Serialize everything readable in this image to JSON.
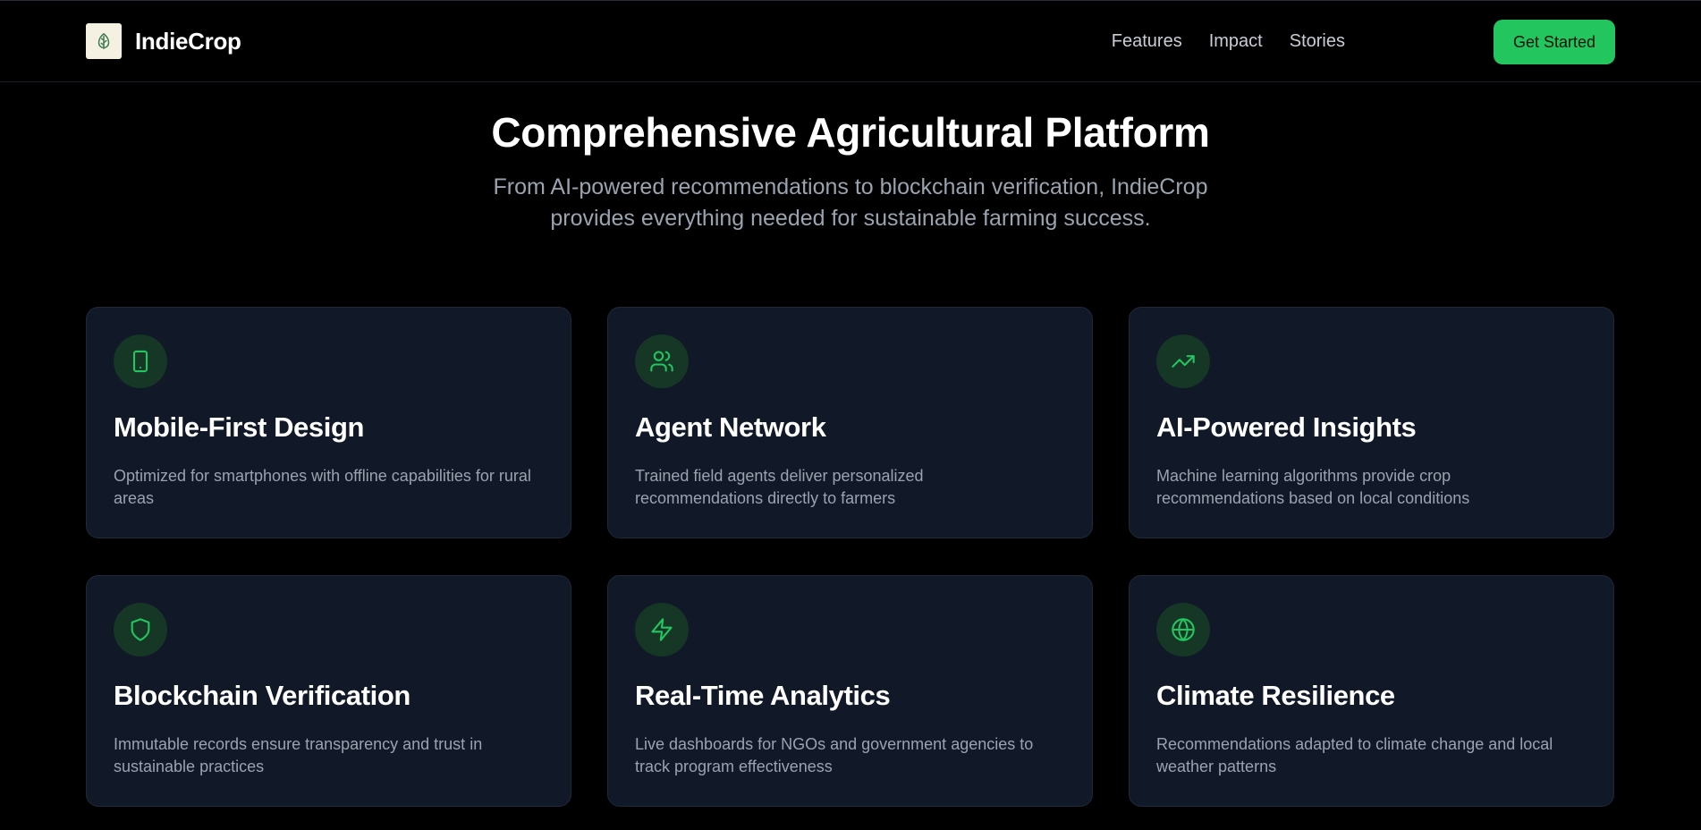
{
  "brand": {
    "name": "IndieCrop",
    "logo_icon": "leaf-icon"
  },
  "nav": {
    "links": [
      {
        "label": "Features"
      },
      {
        "label": "Impact"
      },
      {
        "label": "Stories"
      }
    ],
    "cta_label": "Get Started"
  },
  "hero": {
    "title": "Comprehensive Agricultural Platform",
    "subtitle": "From AI-powered recommendations to blockchain verification, IndieCrop provides everything needed for sustainable farming success."
  },
  "features": [
    {
      "icon": "smartphone-icon",
      "title": "Mobile-First Design",
      "description": "Optimized for smartphones with offline capabilities for rural areas"
    },
    {
      "icon": "users-icon",
      "title": "Agent Network",
      "description": "Trained field agents deliver personalized recommendations directly to farmers"
    },
    {
      "icon": "trending-up-icon",
      "title": "AI-Powered Insights",
      "description": "Machine learning algorithms provide crop recommendations based on local conditions"
    },
    {
      "icon": "shield-icon",
      "title": "Blockchain Verification",
      "description": "Immutable records ensure transparency and trust in sustainable practices"
    },
    {
      "icon": "zap-icon",
      "title": "Real-Time Analytics",
      "description": "Live dashboards for NGOs and government agencies to track program effectiveness"
    },
    {
      "icon": "globe-icon",
      "title": "Climate Resilience",
      "description": "Recommendations adapted to climate change and local weather patterns"
    }
  ],
  "colors": {
    "background": "#000000",
    "card_background": "#111827",
    "accent": "#22c55e",
    "icon_background": "#163626",
    "muted_text": "#9aa3b0"
  }
}
